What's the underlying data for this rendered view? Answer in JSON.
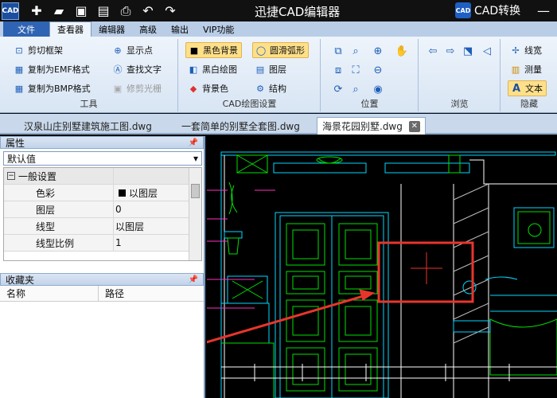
{
  "app": {
    "title": "迅捷CAD编辑器",
    "icon_text": "CAD",
    "convert_label": "CAD转换",
    "convert_icon_text": "CAD"
  },
  "menu": {
    "file": "文件",
    "tabs": [
      "查看器",
      "编辑器",
      "高级",
      "输出",
      "VIP功能"
    ]
  },
  "ribbon": {
    "tools": {
      "label": "工具",
      "items": [
        "剪切框架",
        "复制为EMF格式",
        "复制为BMP格式"
      ],
      "show_point": "显示点",
      "find_text": "查找文字",
      "trim_raster": "修剪光栅"
    },
    "cad_settings": {
      "label": "CAD绘图设置",
      "black_bg": "黑色背景",
      "bw_draw": "黑白绘图",
      "bg_color": "背景色",
      "smooth_arc": "圆滑弧形",
      "layers": "图层",
      "structure": "结构"
    },
    "position": {
      "label": "位置"
    },
    "browse": {
      "label": "浏览"
    },
    "hide": {
      "label": "隐藏",
      "line_width": "线宽",
      "measure": "测量",
      "text": "文本"
    }
  },
  "doc_tabs": [
    "汉泉山庄别墅建筑施工图.dwg",
    "一套简单的别墅全套图.dwg",
    "海景花园别墅.dwg"
  ],
  "properties": {
    "title": "属性",
    "selector": "默认值",
    "category": "一般设置",
    "rows": [
      {
        "name": "色彩",
        "value": "以图层"
      },
      {
        "name": "图层",
        "value": "0"
      },
      {
        "name": "线型",
        "value": "以图层"
      },
      {
        "name": "线型比例",
        "value": "1"
      }
    ]
  },
  "favorites": {
    "title": "收藏夹",
    "col_name": "名称",
    "col_path": "路径"
  },
  "colors": {
    "ribbon_bg": "#dfe9f5",
    "file_tab": "#2f63b3",
    "cad_green": "#00e000",
    "cad_cyan": "#00d8ff",
    "cad_magenta": "#ff30c0",
    "annotation_red": "#e8352c"
  }
}
